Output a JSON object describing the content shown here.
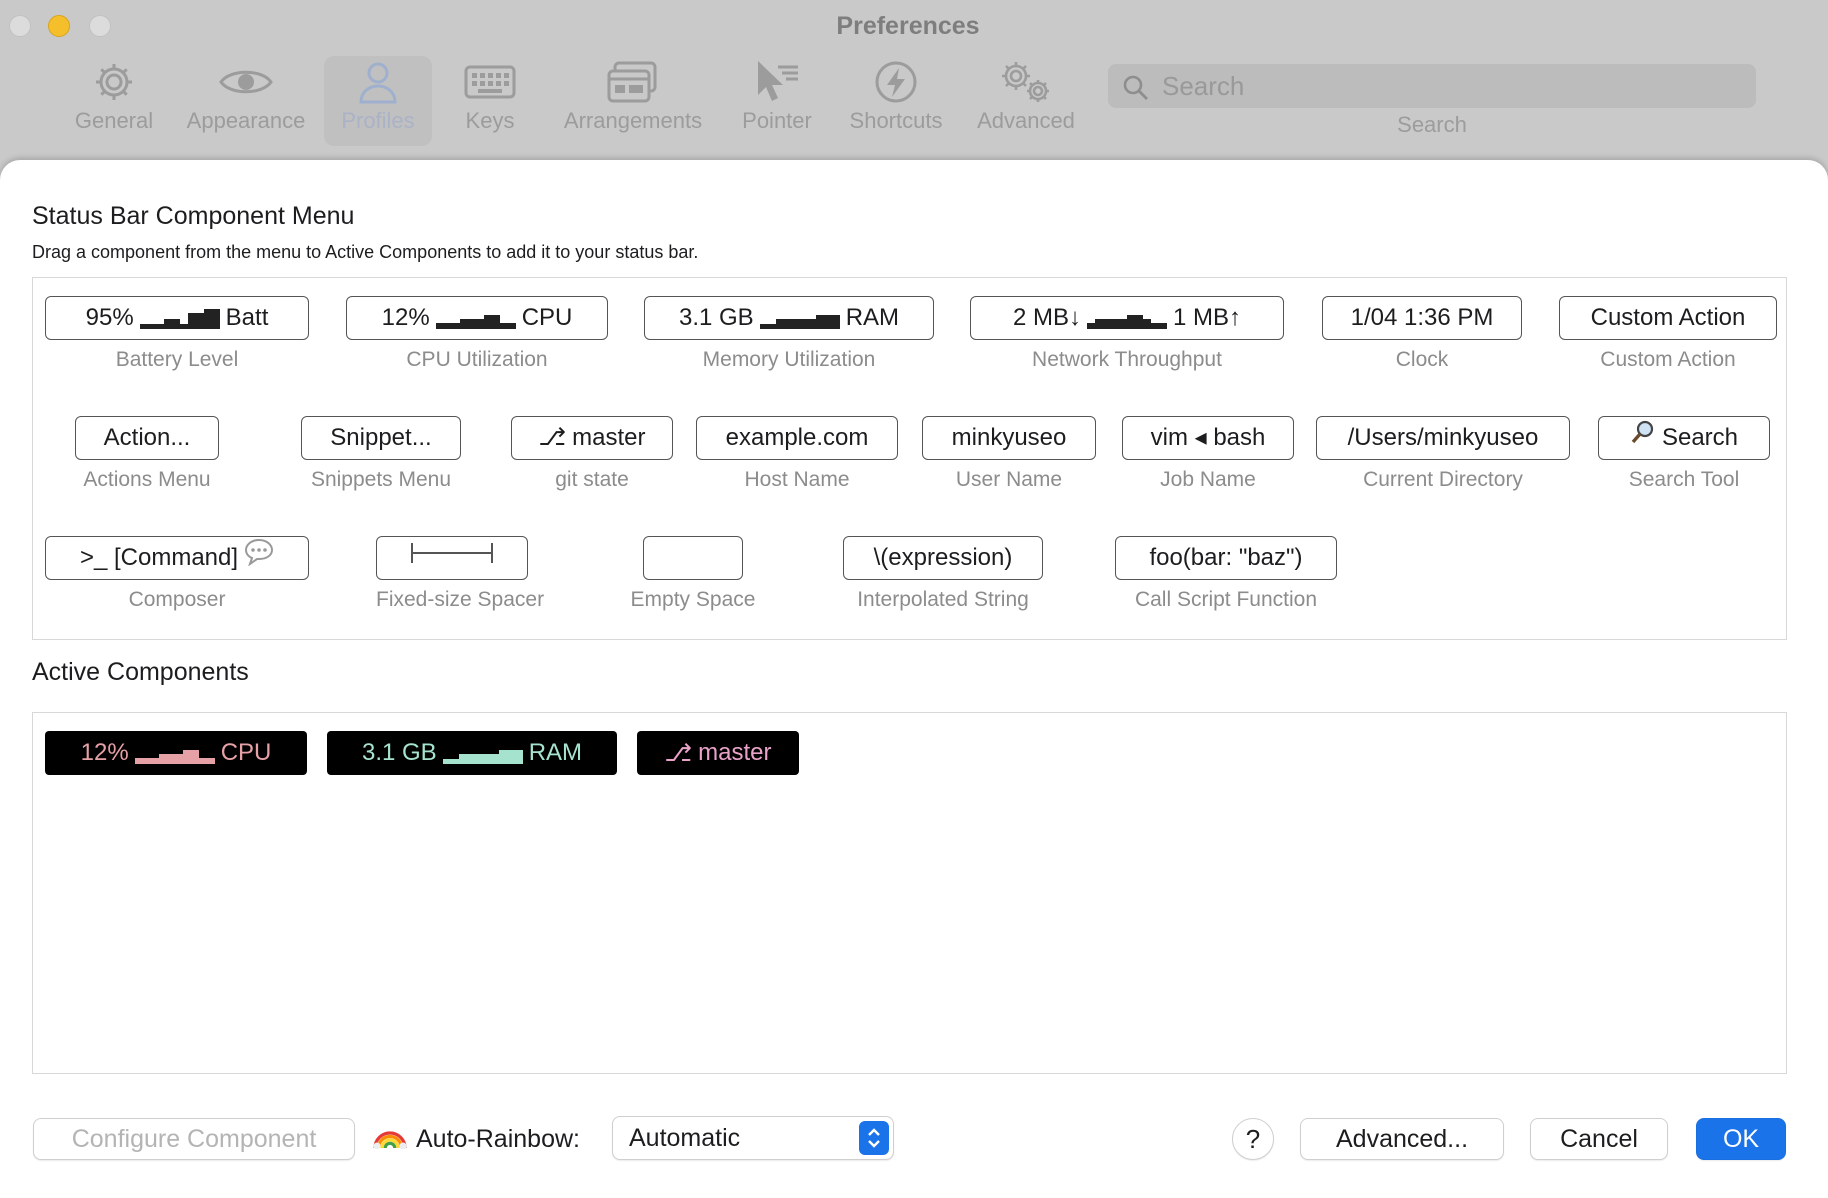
{
  "window": {
    "title": "Preferences"
  },
  "toolbar": {
    "items": [
      {
        "label": "General",
        "icon": "gear-icon"
      },
      {
        "label": "Appearance",
        "icon": "eye-icon"
      },
      {
        "label": "Profiles",
        "icon": "person-icon",
        "selected": true
      },
      {
        "label": "Keys",
        "icon": "keyboard-icon"
      },
      {
        "label": "Arrangements",
        "icon": "windows-icon"
      },
      {
        "label": "Pointer",
        "icon": "pointer-icon"
      },
      {
        "label": "Shortcuts",
        "icon": "bolt-icon"
      },
      {
        "label": "Advanced",
        "icon": "gears-icon"
      }
    ],
    "search_placeholder": "Search",
    "search_caption": "Search"
  },
  "menu": {
    "title": "Status Bar Component Menu",
    "description": "Drag a component from the menu to Active Components to add it to your status bar.",
    "components": [
      {
        "pre": "95%",
        "post": "Batt",
        "caption": "Battery Level"
      },
      {
        "pre": "12%",
        "post": "CPU",
        "caption": "CPU Utilization"
      },
      {
        "pre": "3.1 GB",
        "post": "RAM",
        "caption": "Memory Utilization"
      },
      {
        "pre": "2 MB↓",
        "post": "1 MB↑",
        "caption": "Network Throughput"
      },
      {
        "text": "1/04 1:36 PM",
        "caption": "Clock"
      },
      {
        "text": "Custom Action",
        "caption": "Custom Action"
      },
      {
        "text": "Action...",
        "caption": "Actions Menu"
      },
      {
        "text": "Snippet...",
        "caption": "Snippets Menu"
      },
      {
        "text": "master",
        "caption": "git state"
      },
      {
        "text": "example.com",
        "caption": "Host Name"
      },
      {
        "text": "minkyuseo",
        "caption": "User Name"
      },
      {
        "text": "vim ◂ bash",
        "caption": "Job Name"
      },
      {
        "text": "/Users/minkyuseo",
        "caption": "Current Directory"
      },
      {
        "text": "Search",
        "caption": "Search Tool"
      },
      {
        "text": ">_ [Command]",
        "caption": "Composer"
      },
      {
        "text": "",
        "caption": "Fixed-size Spacer"
      },
      {
        "text": "",
        "caption": "Empty Space"
      },
      {
        "text": "\\(expression)",
        "caption": "Interpolated String"
      },
      {
        "text": "foo(bar: \"baz\")",
        "caption": "Call Script Function"
      }
    ]
  },
  "active": {
    "title": "Active Components",
    "items": [
      {
        "pre": "12%",
        "post": "CPU",
        "color": "#e6a1a6"
      },
      {
        "pre": "3.1 GB",
        "post": "RAM",
        "color": "#a6e3cf"
      },
      {
        "text": "master",
        "color": "#e9a3c9"
      }
    ]
  },
  "footer": {
    "configure_label": "Configure Component",
    "rainbow_label": "Auto-Rainbow:",
    "rainbow_value": "Automatic",
    "help_label": "?",
    "advanced_label": "Advanced...",
    "cancel_label": "Cancel",
    "ok_label": "OK"
  },
  "colors": {
    "accent": "#1a73e8",
    "active_bg": "#000000"
  }
}
